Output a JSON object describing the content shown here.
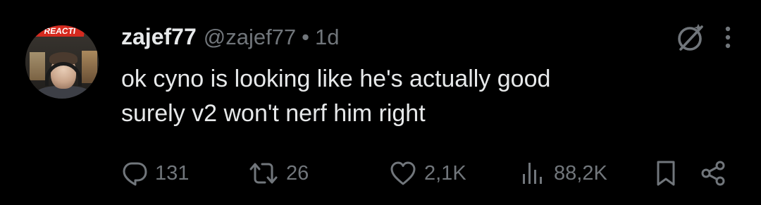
{
  "avatar": {
    "badge_text": "REACTI"
  },
  "author": {
    "display_name": "zajef77",
    "handle": "@zajef77",
    "separator": "•",
    "time": "1d"
  },
  "tweet": {
    "lines": [
      "ok cyno is looking like he's actually good",
      "surely v2 won't nerf him right"
    ]
  },
  "actions": {
    "replies": "131",
    "retweets": "26",
    "likes": "2,1K",
    "views": "88,2K"
  },
  "icons": {
    "top_right": [
      "grok-icon",
      "more-options-icon"
    ],
    "bottom": [
      "reply-icon",
      "retweet-icon",
      "like-icon",
      "views-icon",
      "bookmark-icon",
      "share-icon"
    ]
  },
  "colors": {
    "background": "#000000",
    "primary_text": "#e7e9ea",
    "secondary_text": "#71767b",
    "badge_red": "#d52a1f"
  }
}
